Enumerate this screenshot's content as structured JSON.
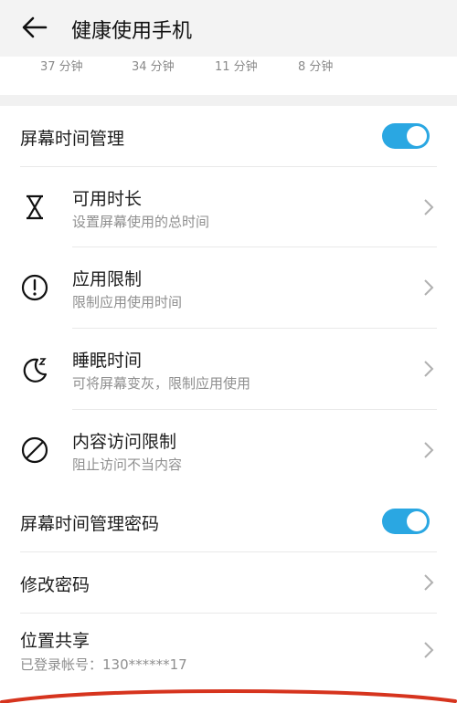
{
  "header": {
    "title": "健康使用手机",
    "back_icon": "back-arrow-icon"
  },
  "usage_times": [
    "37 分钟",
    "34 分钟",
    "11 分钟",
    "8 分钟"
  ],
  "screen_time": {
    "label": "屏幕时间管理",
    "enabled": true,
    "items": [
      {
        "title": "可用时长",
        "subtitle": "设置屏幕使用的总时间",
        "icon": "hourglass-icon"
      },
      {
        "title": "应用限制",
        "subtitle": "限制应用使用时间",
        "icon": "alert-circle-icon"
      },
      {
        "title": "睡眠时间",
        "subtitle": "可将屏幕变灰，限制应用使用",
        "icon": "moon-sleep-icon"
      },
      {
        "title": "内容访问限制",
        "subtitle": "阻止访问不当内容",
        "icon": "block-icon"
      }
    ]
  },
  "password": {
    "label": "屏幕时间管理密码",
    "enabled": true,
    "change_label": "修改密码"
  },
  "location": {
    "title": "位置共享",
    "subtitle": "已登录帐号：130******17"
  },
  "colors": {
    "accent": "#2aa7e2",
    "annotation": "#d6341e"
  }
}
